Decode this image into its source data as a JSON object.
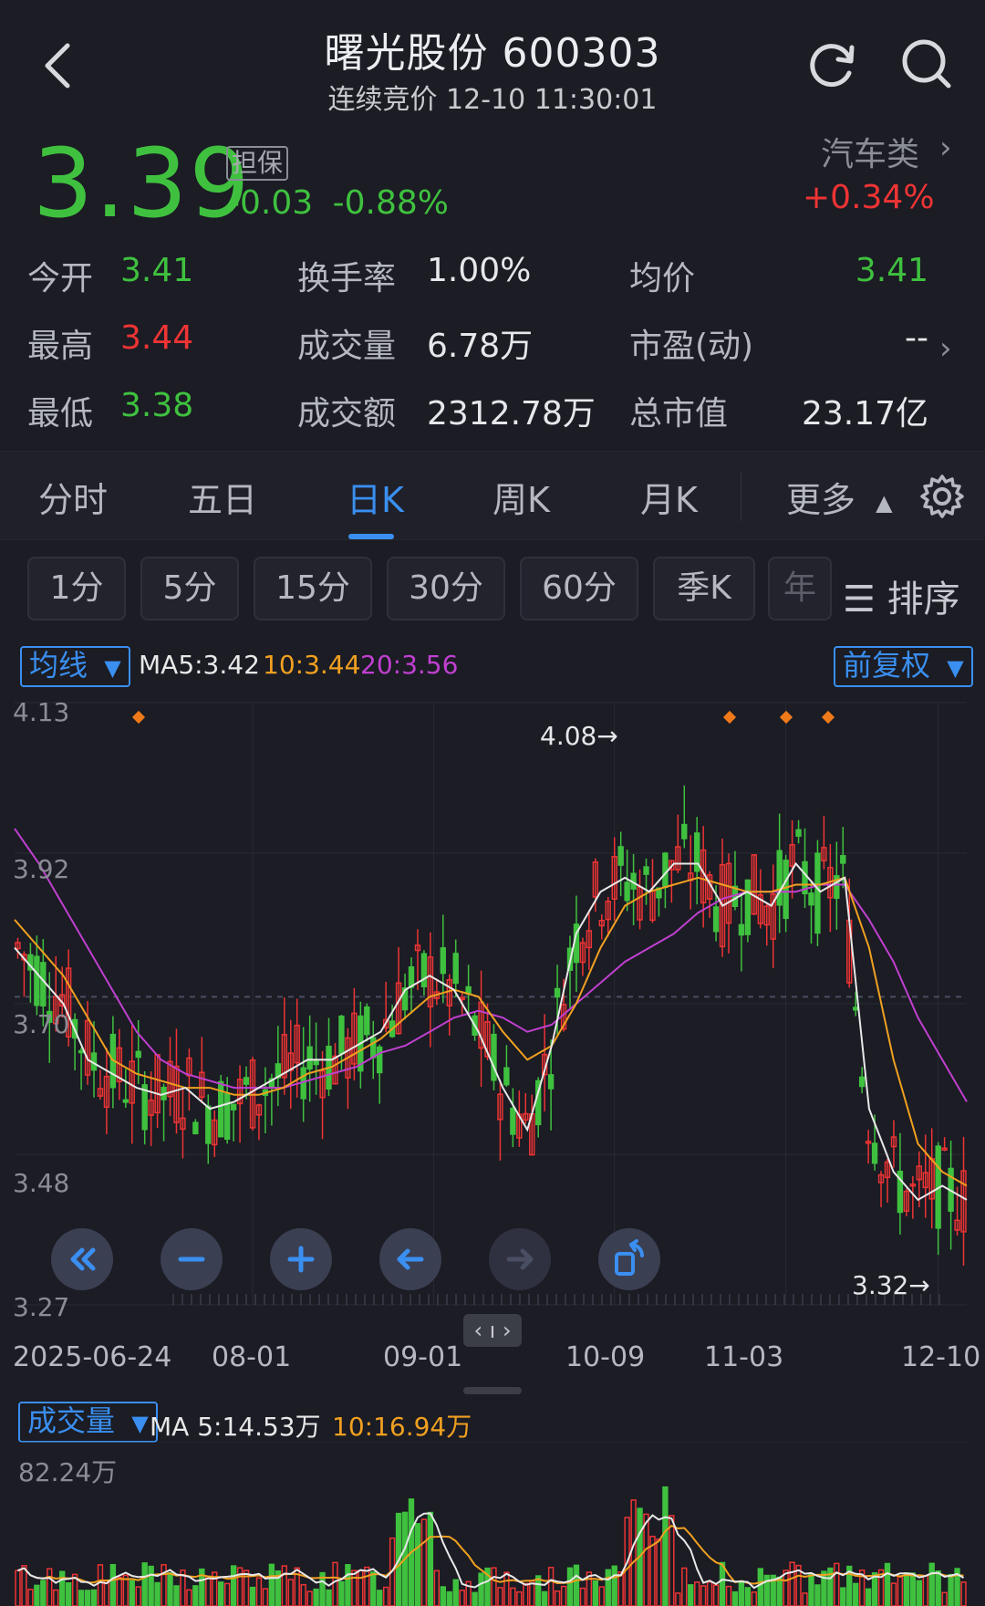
{
  "header": {
    "title": "曙光股份 600303",
    "subtitle": "连续竞价 12-10 11:30:01"
  },
  "quote": {
    "price": "3.39",
    "badge": "担保",
    "change": "-0.03",
    "change_pct": "-0.88%",
    "sector": "汽车类",
    "sector_change": "+0.34%"
  },
  "stats": {
    "open_label": "今开",
    "open": "3.41",
    "high_label": "最高",
    "high": "3.44",
    "low_label": "最低",
    "low": "3.38",
    "turnover_label": "换手率",
    "turnover": "1.00%",
    "volume_label": "成交量",
    "volume": "6.78万",
    "amount_label": "成交额",
    "amount": "2312.78万",
    "avg_label": "均价",
    "avg": "3.41",
    "pe_label": "市盈(动)",
    "pe": "--",
    "mktcap_label": "总市值",
    "mktcap": "23.17亿"
  },
  "tabs": [
    "分时",
    "五日",
    "日K",
    "周K",
    "月K",
    "更多"
  ],
  "active_tab": "日K",
  "periods": [
    "1分",
    "5分",
    "15分",
    "30分",
    "60分",
    "季K",
    "年"
  ],
  "sort_label": "排序",
  "ma_bar": {
    "selector": "均线",
    "ma5": "MA5:3.42",
    "ma10": "10:3.44",
    "ma20": "20:3.56",
    "adjust": "前复权"
  },
  "colors": {
    "up": "#ee3434",
    "down": "#3fc13f",
    "ma5": "#e8e8e8",
    "ma10": "#f0a020",
    "ma20": "#c040d0",
    "accent": "#3a8ff0"
  },
  "chart_data": {
    "type": "candlestick",
    "y_ticks": [
      "4.13",
      "3.92",
      "3.70",
      "3.48",
      "3.27"
    ],
    "ylim": [
      3.27,
      4.13
    ],
    "x_ticks": [
      "2025-06-24",
      "08-01",
      "09-01",
      "10-09",
      "11-03",
      "12-10"
    ],
    "high_label": "4.08→",
    "low_label": "3.32→",
    "ma5_values": [
      3.78,
      3.74,
      3.7,
      3.62,
      3.6,
      3.58,
      3.57,
      3.58,
      3.55,
      3.56,
      3.58,
      3.6,
      3.62,
      3.62,
      3.64,
      3.66,
      3.72,
      3.74,
      3.72,
      3.66,
      3.58,
      3.52,
      3.64,
      3.8,
      3.86,
      3.88,
      3.86,
      3.9,
      3.9,
      3.84,
      3.86,
      3.84,
      3.9,
      3.86,
      3.88,
      3.55,
      3.46,
      3.42,
      3.44,
      3.42
    ],
    "ma10_values": [
      3.82,
      3.78,
      3.74,
      3.68,
      3.62,
      3.6,
      3.59,
      3.58,
      3.58,
      3.57,
      3.57,
      3.58,
      3.6,
      3.61,
      3.63,
      3.65,
      3.68,
      3.71,
      3.72,
      3.71,
      3.66,
      3.62,
      3.64,
      3.7,
      3.78,
      3.84,
      3.86,
      3.87,
      3.88,
      3.87,
      3.86,
      3.86,
      3.87,
      3.87,
      3.88,
      3.78,
      3.62,
      3.5,
      3.46,
      3.44
    ],
    "ma20_values": [
      3.95,
      3.9,
      3.84,
      3.78,
      3.72,
      3.66,
      3.62,
      3.6,
      3.59,
      3.58,
      3.58,
      3.58,
      3.59,
      3.6,
      3.61,
      3.63,
      3.64,
      3.66,
      3.68,
      3.69,
      3.68,
      3.66,
      3.67,
      3.7,
      3.73,
      3.76,
      3.78,
      3.8,
      3.83,
      3.85,
      3.86,
      3.86,
      3.86,
      3.87,
      3.87,
      3.82,
      3.76,
      3.68,
      3.62,
      3.56
    ]
  },
  "controls": [
    "fast-back",
    "zoom-out",
    "zoom-in",
    "left",
    "right",
    "rotate"
  ],
  "volume": {
    "selector": "成交量",
    "ma5": "MA 5:14.53万",
    "ma10": "10:16.94万",
    "max_label": "82.24万"
  }
}
